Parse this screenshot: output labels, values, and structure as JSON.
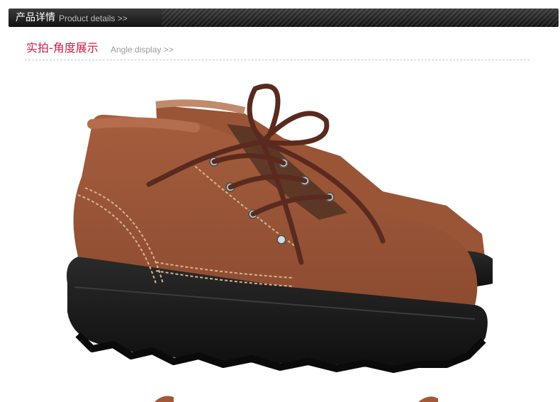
{
  "header": {
    "title": "产品详情",
    "subtitle": "Product details >>"
  },
  "section": {
    "title": "实拍-角度展示",
    "subtitle": "Angle display >>"
  },
  "photo": {
    "icon": "work-boot-photo",
    "colors": {
      "suede": "#a1593a",
      "laces": "#5a2a1f",
      "sole": "#1b1b1b",
      "stitching": "#d7b494"
    }
  }
}
